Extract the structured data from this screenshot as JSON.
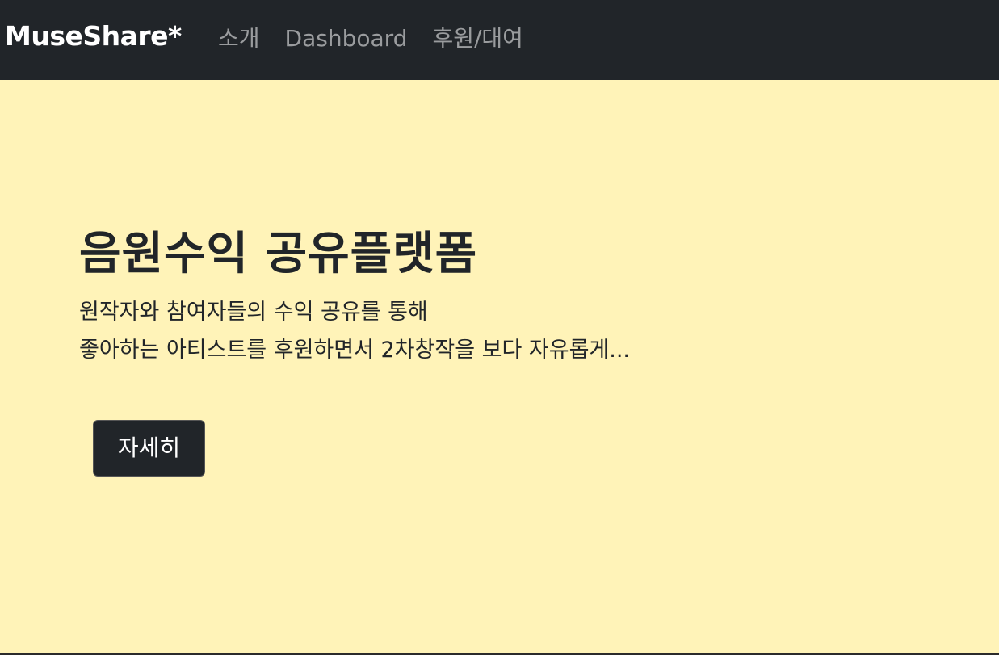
{
  "navbar": {
    "brand": "MuseShare*",
    "links": [
      "소개",
      "Dashboard",
      "후원/대여"
    ]
  },
  "hero": {
    "title": "음원수익 공유플랫폼",
    "subtitle_lines": [
      "원작자와 참여자들의 수익 공유를 통해",
      "좋아하는 아티스트를 후원하면서 2차창작을 보다 자유롭게..."
    ],
    "button_label": "자세히"
  },
  "colors": {
    "navbar_bg": "#212529",
    "hero_bg": "#fff3b8",
    "button_bg": "#212529",
    "text_dark": "#212529"
  }
}
